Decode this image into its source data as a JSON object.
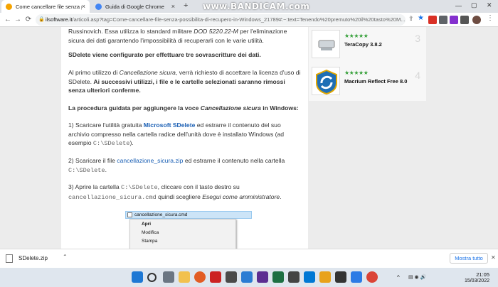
{
  "browser": {
    "tabs": [
      {
        "label": "Come cancellare file senza possib",
        "active": true
      },
      {
        "label": "Guida di Google Chrome",
        "active": false
      }
    ],
    "new_tab": "+",
    "url_domain": "ilsoftware.it",
    "url_path": "/articoli.asp?tag=Come-cancellare-file-senza-possibilita-di-recupero-in-Windows_21789#:~:text=Tenendo%20premuto%20il%20tasto%20M...",
    "watermark": "www.BANDICAM.com"
  },
  "article": {
    "p0": [
      "Russinovich. Essa utilizza lo standard militare ",
      "DOD 5220.22-M",
      " per l'eliminazione sicura dei dati garantendo l'impossibilità di recuperarli con le varie utilità."
    ],
    "p1": "SDelete viene configurato per effettuare tre sovrascritture dei dati.",
    "p2": [
      "Al primo utilizzo di ",
      "Cancellazione sicura",
      ", verrà richiesto di accettare la licenza d'uso di SDelete. ",
      "Ai successivi utilizzi, i file e le cartelle selezionati saranno rimossi senza ulteriori conferme."
    ],
    "p3": [
      "La procedura guidata per aggiungere la voce ",
      "Cancellazione sicura",
      " in Windows:"
    ],
    "p4": [
      "1) Scaricare l'utilità gratuita ",
      "Microsoft SDelete",
      " ed estrarre il contenuto del suo archivio compresso nella cartella radice dell'unità dove è installato Windows (ad esempio ",
      "C:\\SDelete",
      ")."
    ],
    "p5": [
      "2) Scaricare il file ",
      "cancellazione_sicura.zip",
      " ed estrarne il contenuto nella cartella ",
      "C:\\SDelete",
      "."
    ],
    "p6": [
      "3) Aprire la cartella ",
      "C:\\SDelete",
      ", cliccare con il tasto destro su ",
      "cancellazione_sicura.cmd",
      " quindi scegliere ",
      "Esegui come amministratore",
      "."
    ]
  },
  "screenshot_in_article": {
    "file": "cancellazione_sicura.cmd",
    "menu": [
      "Apri",
      "Modifica",
      "Stampa"
    ]
  },
  "sidebar": {
    "items": [
      {
        "name": "TeraCopy 3.8.2",
        "stars": "★★★★★",
        "rank": "3"
      },
      {
        "name": "Macrium Reflect Free 8.0",
        "stars": "★★★★★",
        "rank": "4"
      }
    ]
  },
  "downloads": {
    "file": "SDelete.zip",
    "show_all": "Mostra tutto",
    "close": "✕"
  },
  "taskbar": {
    "time": "21:05",
    "date": "15/03/2022"
  },
  "colors": {
    "link": "#1a5fb4",
    "stars": "#37a13b"
  }
}
